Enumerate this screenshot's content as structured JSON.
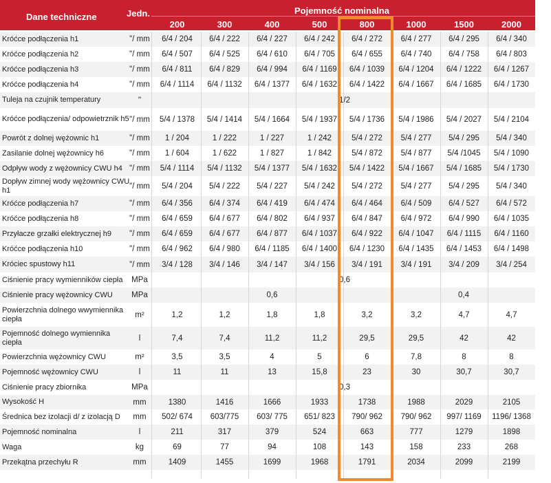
{
  "header": {
    "params_label": "Dane techniczne",
    "unit_label": "Jedn.",
    "group_label": "Pojemność nominalna",
    "volumes": [
      "200",
      "300",
      "400",
      "500",
      "800",
      "1000",
      "1500",
      "2000"
    ]
  },
  "highlight": {
    "column": "800",
    "color": "#f08a2a"
  },
  "colors": {
    "header_bg": "#c8202e",
    "highlight_border": "#f08a2a"
  },
  "rows": [
    {
      "name": "Króćce podłączenia h1",
      "unit": "\"/ mm",
      "values": [
        "6/4 / 204",
        "6/4 / 222",
        "6/4 / 227",
        "6/4 / 242",
        "6/4 / 272",
        "6/4 / 277",
        "6/4 / 295",
        "6/4 / 340"
      ]
    },
    {
      "name": "Króćce podłączenia h2",
      "unit": "\"/ mm",
      "values": [
        "6/4 / 507",
        "6/4 / 525",
        "6/4 / 610",
        "6/4 / 705",
        "6/4 / 655",
        "6/4 / 740",
        "6/4 / 758",
        "6/4 / 803"
      ]
    },
    {
      "name": "Króćce podłączenia h3",
      "unit": "\"/ mm",
      "values": [
        "6/4 / 811",
        "6/4 / 829",
        "6/4 / 994",
        "6/4 / 1169",
        "6/4 / 1039",
        "6/4 / 1204",
        "6/4 / 1222",
        "6/4 / 1267"
      ]
    },
    {
      "name": "Króćce podłączenia h4",
      "unit": "\"/ mm",
      "values": [
        "6/4 / 1114",
        "6/4 / 1132",
        "6/4 / 1377",
        "6/4 / 1632",
        "6/4 / 1422",
        "6/4 / 1667",
        "6/4 / 1685",
        "6/4 / 1730"
      ]
    },
    {
      "name": "Tuleja na czujnik temperatury",
      "unit": "\"",
      "merged": "1/2"
    },
    {
      "name": "Króćce podłączenia/ odpowietrznik h5",
      "unit": "\"/ mm",
      "values": [
        "5/4 / 1378",
        "5/4 / 1414",
        "5/4 / 1664",
        "5/4 / 1937",
        "5/4 / 1736",
        "5/4 / 1986",
        "5/4 / 2027",
        "5/4 / 2104"
      ]
    },
    {
      "name": "Powrót z dolnej wężownic h1",
      "unit": "\"/ mm",
      "values": [
        "1 / 204",
        "1 / 222",
        "1 / 227",
        "1 / 242",
        "5/4 / 272",
        "5/4 / 277",
        "5/4 / 295",
        "5/4 / 340"
      ]
    },
    {
      "name": "Zasilanie dolnej wężownicy h6",
      "unit": "\"/ mm",
      "values": [
        "1 / 604",
        "1 / 622",
        "1 / 827",
        "1 / 842",
        "5/4 / 872",
        "5/4 / 877",
        "5/4 /1045",
        "5/4 / 1090"
      ]
    },
    {
      "name": "Odpływ wody z wężownicy CWU h4",
      "unit": "\"/ mm",
      "values": [
        "5/4 / 1114",
        "5/4 / 1132",
        "5/4 / 1377",
        "5/4 / 1632",
        "5/4 / 1422",
        "5/4 / 1667",
        "5/4 / 1685",
        "5/4 / 1730"
      ]
    },
    {
      "name": "Dopływ zimnej wody wężownicy CWU h1",
      "unit": "\"/ mm",
      "values": [
        "5/4 / 204",
        "5/4 / 222",
        "5/4 / 227",
        "5/4 / 242",
        "5/4 / 272",
        "5/4 / 277",
        "5/4 / 295",
        "5/4 / 340"
      ]
    },
    {
      "name": "Króćce podłączenia h7",
      "unit": "\"/ mm",
      "values": [
        "6/4 / 356",
        "6/4 / 374",
        "6/4 / 419",
        "6/4 / 474",
        "6/4 / 464",
        "6/4 / 509",
        "6/4 / 527",
        "6/4 / 572"
      ]
    },
    {
      "name": "Króćce podłączenia h8",
      "unit": "\"/ mm",
      "values": [
        "6/4 / 659",
        "6/4 / 677",
        "6/4 / 802",
        "6/4 / 937",
        "6/4 / 847",
        "6/4 / 972",
        "6/4 / 990",
        "6/4 / 1035"
      ]
    },
    {
      "name": "Przyłacze grzałki elektrycznej h9",
      "unit": "\"/ mm",
      "values": [
        "6/4 / 659",
        "6/4 / 677",
        "6/4 / 877",
        "6/4 / 1037",
        "6/4 / 922",
        "6/4 / 1047",
        "6/4 / 1115",
        "6/4 / 1160"
      ]
    },
    {
      "name": "Króćce podłączenia h10",
      "unit": "\"/ mm",
      "values": [
        "6/4 / 962",
        "6/4 / 980",
        "6/4 / 1185",
        "6/4 / 1400",
        "6/4 / 1230",
        "6/4 / 1435",
        "6/4 / 1453",
        "6/4 / 1498"
      ]
    },
    {
      "name": "Króciec spustowy h11",
      "unit": "\"/ mm",
      "values": [
        "3/4 / 128",
        "3/4 / 146",
        "3/4 / 147",
        "3/4 / 156",
        "3/4 / 191",
        "3/4 / 191",
        "3/4 / 209",
        "3/4 / 254"
      ]
    },
    {
      "name": "Ciśnienie pracy wymienników ciepła",
      "unit": "MPa",
      "merged": "0,6"
    },
    {
      "name": "Ciśnienie pracy wężownicy CWU",
      "unit": "MPa",
      "groups": [
        "0,6",
        "0,4"
      ]
    },
    {
      "name": "Powierzchnia dolnego wwymiennika ciepła",
      "unit": "m²",
      "values": [
        "1,2",
        "1,2",
        "1,8",
        "1,8",
        "3,2",
        "3,2",
        "4,7",
        "4,7"
      ]
    },
    {
      "name": "Pojemność dolnego wymiennika ciepła",
      "unit": "l",
      "values": [
        "7,4",
        "7,4",
        "11,2",
        "11,2",
        "29,5",
        "29,5",
        "42",
        "42"
      ]
    },
    {
      "name": "Powierzchnia wężownicy CWU",
      "unit": "m²",
      "values": [
        "3,5",
        "3,5",
        "4",
        "5",
        "6",
        "7,8",
        "8",
        "8"
      ]
    },
    {
      "name": "Pojemność wężownicy CWU",
      "unit": "l",
      "values": [
        "11",
        "11",
        "13",
        "15,8",
        "23",
        "30",
        "30,7",
        "30,7"
      ]
    },
    {
      "name": "Ciśnienie pracy zbiornika",
      "unit": "MPa",
      "merged": "0,3"
    },
    {
      "name": "Wysokość H",
      "unit": "mm",
      "values": [
        "1380",
        "1416",
        "1666",
        "1933",
        "1738",
        "1988",
        "2029",
        "2105"
      ]
    },
    {
      "name": "Średnica bez izolacji d/ z izolacją D",
      "unit": "mm",
      "values": [
        "502/ 674",
        "603/775",
        "603/ 775",
        "651/ 823",
        "790/ 962",
        "790/ 962",
        "997/ 1169",
        "1196/ 1368"
      ]
    },
    {
      "name": "Pojemność nominalna",
      "unit": "l",
      "values": [
        "211",
        "317",
        "379",
        "524",
        "663",
        "777",
        "1279",
        "1898"
      ]
    },
    {
      "name": "Waga",
      "unit": "kg",
      "values": [
        "69",
        "77",
        "94",
        "108",
        "143",
        "158",
        "233",
        "268"
      ]
    },
    {
      "name": "Przekątna przechyłu R",
      "unit": "mm",
      "values": [
        "1409",
        "1455",
        "1699",
        "1968",
        "1791",
        "2034",
        "2099",
        "2199"
      ]
    }
  ]
}
